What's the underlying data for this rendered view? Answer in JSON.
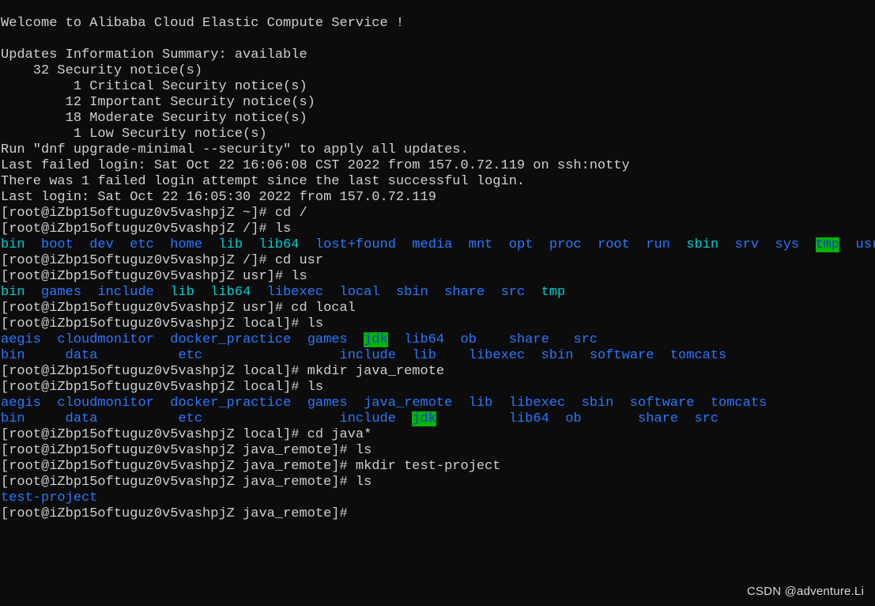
{
  "terminal": {
    "background_color": "#0c0c0c",
    "default_text_color": "#cfcfcf",
    "dir_color": "#2878ff",
    "link_color": "#00cdcd",
    "sticky_bg_color": "#00b400",
    "sticky_fg_color": "#1040d0",
    "hostname": "iZbp15oftuguz0v5vashpjZ",
    "user": "root",
    "banner": {
      "welcome": "Welcome to Alibaba Cloud Elastic Compute Service !",
      "updates_summary": "Updates Information Summary: available",
      "notices": [
        "    32 Security notice(s)",
        "         1 Critical Security notice(s)",
        "        12 Important Security notice(s)",
        "        18 Moderate Security notice(s)",
        "         1 Low Security notice(s)"
      ],
      "run_hint": "Run \"dnf upgrade-minimal --security\" to apply all updates.",
      "last_failed_login": "Last failed login: Sat Oct 22 16:06:08 CST 2022 from 157.0.72.119 on ssh:notty",
      "failed_attempts": "There was 1 failed login attempt since the last successful login.",
      "last_login": "Last login: Sat Oct 22 16:05:30 2022 from 157.0.72.119"
    },
    "prompts": {
      "home": "[root@iZbp15oftuguz0v5vashpjZ ~]# ",
      "root_dir": "[root@iZbp15oftuguz0v5vashpjZ /]# ",
      "usr": "[root@iZbp15oftuguz0v5vashpjZ usr]# ",
      "local": "[root@iZbp15oftuguz0v5vashpjZ local]# ",
      "java_remote": "[root@iZbp15oftuguz0v5vashpjZ java_remote]# "
    },
    "commands": {
      "cd_root": "cd /",
      "ls": "ls",
      "cd_usr": "cd usr",
      "cd_local": "cd local",
      "mkdir_java_remote": "mkdir java_remote",
      "cd_java_glob": "cd java*",
      "mkdir_test_project": "mkdir test-project"
    },
    "listings": {
      "root": [
        {
          "name": "bin",
          "type": "link",
          "pad": "  "
        },
        {
          "name": "boot",
          "type": "dir",
          "pad": "  "
        },
        {
          "name": "dev",
          "type": "dir",
          "pad": "  "
        },
        {
          "name": "etc",
          "type": "dir",
          "pad": "  "
        },
        {
          "name": "home",
          "type": "dir",
          "pad": "  "
        },
        {
          "name": "lib",
          "type": "link",
          "pad": "  "
        },
        {
          "name": "lib64",
          "type": "link",
          "pad": "  "
        },
        {
          "name": "lost+found",
          "type": "dir",
          "pad": "  "
        },
        {
          "name": "media",
          "type": "dir",
          "pad": "  "
        },
        {
          "name": "mnt",
          "type": "dir",
          "pad": "  "
        },
        {
          "name": "opt",
          "type": "dir",
          "pad": "  "
        },
        {
          "name": "proc",
          "type": "dir",
          "pad": "  "
        },
        {
          "name": "root",
          "type": "dir",
          "pad": "  "
        },
        {
          "name": "run",
          "type": "dir",
          "pad": "  "
        },
        {
          "name": "sbin",
          "type": "link",
          "pad": "  "
        },
        {
          "name": "srv",
          "type": "dir",
          "pad": "  "
        },
        {
          "name": "sys",
          "type": "dir",
          "pad": "  "
        },
        {
          "name": "tmp",
          "type": "sticky",
          "pad": "  "
        },
        {
          "name": "usr",
          "type": "dir",
          "pad": ""
        }
      ],
      "usr": [
        {
          "name": "bin",
          "type": "link",
          "pad": "  "
        },
        {
          "name": "games",
          "type": "dir",
          "pad": "  "
        },
        {
          "name": "include",
          "type": "dir",
          "pad": "  "
        },
        {
          "name": "lib",
          "type": "link",
          "pad": "  "
        },
        {
          "name": "lib64",
          "type": "link",
          "pad": "  "
        },
        {
          "name": "libexec",
          "type": "dir",
          "pad": "  "
        },
        {
          "name": "local",
          "type": "dir",
          "pad": "  "
        },
        {
          "name": "sbin",
          "type": "dir",
          "pad": "  "
        },
        {
          "name": "share",
          "type": "dir",
          "pad": "  "
        },
        {
          "name": "src",
          "type": "dir",
          "pad": "  "
        },
        {
          "name": "tmp",
          "type": "link",
          "pad": ""
        }
      ],
      "local_before": {
        "row1": [
          {
            "name": "aegis",
            "type": "dir",
            "pad": "  "
          },
          {
            "name": "cloudmonitor",
            "type": "dir",
            "pad": "  "
          },
          {
            "name": "docker_practice",
            "type": "dir",
            "pad": "  "
          },
          {
            "name": "games",
            "type": "dir",
            "pad": "  "
          },
          {
            "name": "jdk",
            "type": "sticky",
            "pad": "  "
          },
          {
            "name": "lib64",
            "type": "dir",
            "pad": "  "
          },
          {
            "name": "ob",
            "type": "dir",
            "pad": "    "
          },
          {
            "name": "share",
            "type": "dir",
            "pad": "   "
          },
          {
            "name": "src",
            "type": "dir",
            "pad": ""
          }
        ],
        "row2": [
          {
            "name": "bin",
            "type": "dir",
            "pad": "     "
          },
          {
            "name": "data",
            "type": "dir",
            "pad": "          "
          },
          {
            "name": "etc",
            "type": "dir",
            "pad": "                 "
          },
          {
            "name": "include",
            "type": "dir",
            "pad": "  "
          },
          {
            "name": "lib",
            "type": "dir",
            "pad": "    "
          },
          {
            "name": "libexec",
            "type": "dir",
            "pad": "  "
          },
          {
            "name": "sbin",
            "type": "dir",
            "pad": "  "
          },
          {
            "name": "software",
            "type": "dir",
            "pad": "  "
          },
          {
            "name": "tomcats",
            "type": "dir",
            "pad": ""
          }
        ]
      },
      "local_after": {
        "row1": [
          {
            "name": "aegis",
            "type": "dir",
            "pad": "  "
          },
          {
            "name": "cloudmonitor",
            "type": "dir",
            "pad": "  "
          },
          {
            "name": "docker_practice",
            "type": "dir",
            "pad": "  "
          },
          {
            "name": "games",
            "type": "dir",
            "pad": "  "
          },
          {
            "name": "java_remote",
            "type": "dir",
            "pad": "  "
          },
          {
            "name": "lib",
            "type": "dir",
            "pad": "  "
          },
          {
            "name": "libexec",
            "type": "dir",
            "pad": "  "
          },
          {
            "name": "sbin",
            "type": "dir",
            "pad": "  "
          },
          {
            "name": "software",
            "type": "dir",
            "pad": "  "
          },
          {
            "name": "tomcats",
            "type": "dir",
            "pad": ""
          }
        ],
        "row2": [
          {
            "name": "bin",
            "type": "dir",
            "pad": "     "
          },
          {
            "name": "data",
            "type": "dir",
            "pad": "          "
          },
          {
            "name": "etc",
            "type": "dir",
            "pad": "                 "
          },
          {
            "name": "include",
            "type": "dir",
            "pad": "  "
          },
          {
            "name": "jdk",
            "type": "sticky",
            "pad": "         "
          },
          {
            "name": "lib64",
            "type": "dir",
            "pad": "  "
          },
          {
            "name": "ob",
            "type": "dir",
            "pad": "       "
          },
          {
            "name": "share",
            "type": "dir",
            "pad": "  "
          },
          {
            "name": "src",
            "type": "dir",
            "pad": ""
          }
        ]
      },
      "java_remote": [
        {
          "name": "test-project",
          "type": "dir",
          "pad": ""
        }
      ]
    }
  },
  "watermark": {
    "text": "CSDN @adventure.Li"
  }
}
